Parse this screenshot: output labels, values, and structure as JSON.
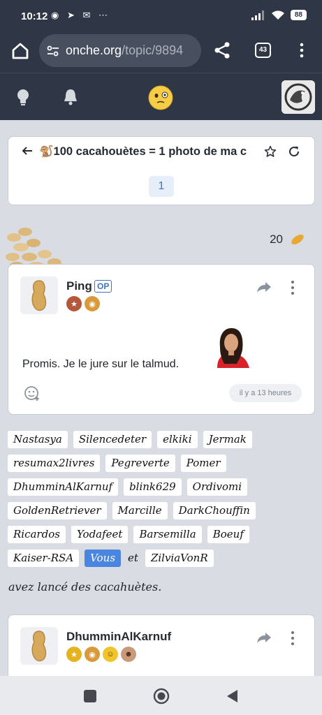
{
  "status_bar": {
    "time": "10:12",
    "notification_icons": "◉ ➤ ✉ ⋯",
    "battery": "88"
  },
  "browser": {
    "url_host": "onche.org",
    "url_path": "/topic/9894",
    "tab_count": "43"
  },
  "topic": {
    "title": "🐒100 cacahouètes = 1 photo de ma c",
    "page": "1",
    "peanut_count": "20"
  },
  "posts": [
    {
      "author": "Ping",
      "op_label": "OP",
      "message": "Promis. Je le jure sur le talmud.",
      "time": "il y a 13 heures",
      "badges": [
        "star-badge",
        "peanut-badge"
      ]
    },
    {
      "author": "DhumminAlKarnuf",
      "badges": [
        "star-badge",
        "peanut-badge",
        "smile-badge",
        "monkey-badge"
      ]
    }
  ],
  "reactions": {
    "users": [
      "Nastasya",
      "Silencedeter",
      "elkiki",
      "Jermak",
      "resumax2livres",
      "Pegreverte",
      "Pomer",
      "DhumminAlKarnuf",
      "blink629",
      "Ordivomi",
      "GoldenRetriever",
      "Marcille",
      "DarkChouffin",
      "Ricardos",
      "Yodafeet",
      "Barsemilla",
      "Boeuf",
      "Kaiser-RSA"
    ],
    "you": "Vous",
    "and": "et",
    "last": "ZilviaVonR",
    "launched_text": "avez lancé des cacahuètes."
  },
  "colors": {
    "header_bg": "#2f3645",
    "page_bg": "#d9dce2",
    "accent": "#3f74c6",
    "vous_chip": "#4a86e0"
  }
}
